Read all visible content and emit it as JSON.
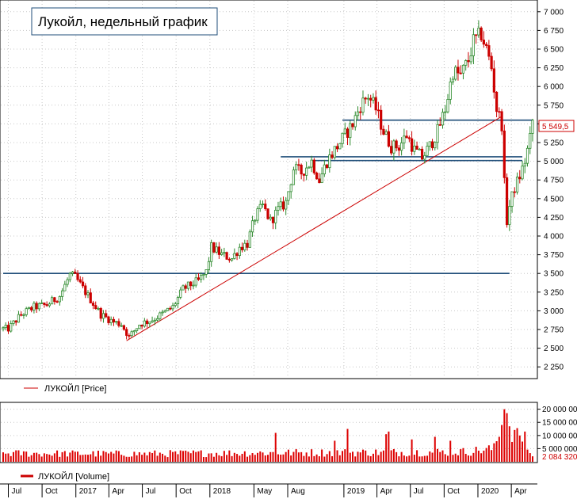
{
  "chart_data": [
    {
      "type": "candlestick",
      "title": "Лукойл, недельный график",
      "legend": "ЛУКОЙЛ [Price]",
      "ylim": [
        2125,
        7125
      ],
      "y_ticks": [
        2250,
        2500,
        2750,
        3000,
        3250,
        3500,
        3750,
        4000,
        4250,
        4500,
        4750,
        5000,
        5250,
        5500,
        5750,
        6000,
        6250,
        6500,
        6750,
        7000
      ],
      "y_tick_labels": [
        "2 250",
        "2 500",
        "2 750",
        "3 000",
        "3 250",
        "3 500",
        "3 750",
        "4 000",
        "4 250",
        "4 500",
        "4 750",
        "5 000",
        "5 250",
        "5 500",
        "5 750",
        "6 000",
        "6 250",
        "6 500",
        "6 750",
        "7 000"
      ],
      "last_price": 5549.5,
      "last_price_label": "5 549,5",
      "grid": true,
      "legend_position": "bottom-left",
      "keypoints": [
        [
          "2016-07-01",
          2760
        ],
        [
          "2016-08-05",
          2950
        ],
        [
          "2016-09-09",
          3050
        ],
        [
          "2016-10-14",
          3080
        ],
        [
          "2016-11-18",
          3200
        ],
        [
          "2016-12-16",
          3480
        ],
        [
          "2016-12-30",
          3450
        ],
        [
          "2017-01-20",
          3300
        ],
        [
          "2017-02-10",
          3150
        ],
        [
          "2017-03-10",
          2950
        ],
        [
          "2017-04-14",
          2850
        ],
        [
          "2017-05-05",
          2820
        ],
        [
          "2017-05-26",
          2650
        ],
        [
          "2017-06-23",
          2820
        ],
        [
          "2017-07-28",
          2880
        ],
        [
          "2017-08-25",
          2960
        ],
        [
          "2017-09-22",
          3050
        ],
        [
          "2017-10-20",
          3290
        ],
        [
          "2017-11-10",
          3350
        ],
        [
          "2017-12-01",
          3400
        ],
        [
          "2017-12-22",
          3520
        ],
        [
          "2018-01-05",
          3850
        ],
        [
          "2018-02-02",
          3750
        ],
        [
          "2018-03-02",
          3700
        ],
        [
          "2018-03-23",
          3850
        ],
        [
          "2018-04-13",
          3900
        ],
        [
          "2018-05-04",
          4250
        ],
        [
          "2018-05-25",
          4400
        ],
        [
          "2018-06-15",
          4200
        ],
        [
          "2018-07-06",
          4350
        ],
        [
          "2018-07-27",
          4450
        ],
        [
          "2018-08-17",
          4900
        ],
        [
          "2018-09-07",
          4850
        ],
        [
          "2018-10-05",
          5000
        ],
        [
          "2018-10-26",
          4750
        ],
        [
          "2018-11-16",
          5000
        ],
        [
          "2018-12-07",
          5150
        ],
        [
          "2018-12-28",
          5300
        ],
        [
          "2019-01-25",
          5500
        ],
        [
          "2019-02-15",
          5750
        ],
        [
          "2019-03-08",
          5880
        ],
        [
          "2019-03-29",
          5700
        ],
        [
          "2019-04-19",
          5400
        ],
        [
          "2019-05-10",
          5200
        ],
        [
          "2019-05-31",
          5200
        ],
        [
          "2019-06-21",
          5350
        ],
        [
          "2019-07-12",
          5150
        ],
        [
          "2019-08-02",
          5050
        ],
        [
          "2019-08-23",
          5200
        ],
        [
          "2019-09-13",
          5400
        ],
        [
          "2019-10-04",
          5700
        ],
        [
          "2019-10-25",
          6200
        ],
        [
          "2019-11-15",
          6150
        ],
        [
          "2019-12-06",
          6350
        ],
        [
          "2019-12-20",
          6600
        ],
        [
          "2020-01-10",
          6700
        ],
        [
          "2020-01-24",
          6500
        ],
        [
          "2020-02-07",
          6250
        ],
        [
          "2020-02-21",
          5700
        ],
        [
          "2020-03-06",
          5500
        ],
        [
          "2020-03-13",
          4700
        ],
        [
          "2020-03-20",
          4200
        ],
        [
          "2020-03-27",
          4400
        ],
        [
          "2020-04-10",
          4650
        ],
        [
          "2020-04-24",
          4800
        ],
        [
          "2020-05-08",
          5000
        ],
        [
          "2020-05-22",
          5300
        ],
        [
          "2020-05-29",
          5549.5
        ]
      ],
      "trend_line": {
        "from": [
          "2017-05-19",
          2600
        ],
        "to": [
          "2020-03-06",
          5600
        ]
      },
      "support_lines": [
        {
          "from": [
            "2016-06-17",
            3500
          ],
          "to": [
            "2020-03-27",
            3500
          ]
        },
        {
          "from": [
            "2018-07-13",
            5060
          ],
          "to": [
            "2020-05-01",
            5060
          ]
        },
        {
          "from": [
            "2018-10-05",
            5010
          ],
          "to": [
            "2020-05-01",
            5010
          ]
        },
        {
          "from": [
            "2018-12-28",
            5550
          ],
          "to": [
            "2020-05-29",
            5550
          ]
        }
      ],
      "colors": {
        "up": "#2e8b2e",
        "down": "#cc0000",
        "trend": "#cc0000",
        "support": "#1f4e79"
      }
    },
    {
      "type": "bar",
      "legend": "ЛУКОЙЛ [Volume]",
      "ylim": [
        0,
        22000000
      ],
      "y_ticks": [
        5000000,
        10000000,
        15000000,
        20000000
      ],
      "y_tick_labels": [
        "5 000 000",
        "10 000 000",
        "15 000 000",
        "20 000 000"
      ],
      "last_value": 2084320,
      "last_value_label": "2 084 320",
      "keypoints": [
        [
          "2016-06-17",
          3200000
        ],
        [
          "2017-06-01",
          3000000
        ],
        [
          "2018-06-01",
          3400000
        ],
        [
          "2019-06-01",
          3600000
        ],
        [
          "2019-12-01",
          3800000
        ],
        [
          "2020-02-14",
          5000000
        ],
        [
          "2020-03-13",
          19500000
        ],
        [
          "2020-04-10",
          10500000
        ],
        [
          "2020-05-29",
          3000000
        ]
      ],
      "spikes": [
        [
          "2018-06-29",
          11000000
        ],
        [
          "2018-12-07",
          8000000
        ],
        [
          "2019-01-11",
          12500000
        ],
        [
          "2019-04-26",
          10500000
        ],
        [
          "2019-05-03",
          11500000
        ],
        [
          "2019-07-05",
          8500000
        ],
        [
          "2019-09-06",
          9500000
        ],
        [
          "2019-10-18",
          8000000
        ],
        [
          "2020-02-28",
          9500000
        ],
        [
          "2020-03-06",
          14000000
        ],
        [
          "2020-03-13",
          20000000
        ],
        [
          "2020-03-20",
          18500000
        ],
        [
          "2020-03-27",
          13500000
        ],
        [
          "2020-04-24",
          10000000
        ],
        [
          "2020-05-08",
          11500000
        ]
      ],
      "colors": {
        "bar": "#dd0000"
      }
    }
  ],
  "x_axis": {
    "labels": [
      {
        "date": "2016-07-01",
        "text": "Jul"
      },
      {
        "date": "2016-10-01",
        "text": "Oct"
      },
      {
        "date": "2017-01-01",
        "text": "2017"
      },
      {
        "date": "2017-04-01",
        "text": "Apr"
      },
      {
        "date": "2017-07-01",
        "text": "Jul"
      },
      {
        "date": "2017-10-01",
        "text": "Oct"
      },
      {
        "date": "2018-01-01",
        "text": "2018"
      },
      {
        "date": "2018-05-01",
        "text": "May"
      },
      {
        "date": "2018-08-01",
        "text": "Aug"
      },
      {
        "date": "2019-01-01",
        "text": "2019"
      },
      {
        "date": "2019-04-01",
        "text": "Apr"
      },
      {
        "date": "2019-07-01",
        "text": "Jul"
      },
      {
        "date": "2019-10-01",
        "text": "Oct"
      },
      {
        "date": "2020-01-01",
        "text": "2020"
      },
      {
        "date": "2020-04-01",
        "text": "Apr"
      }
    ]
  }
}
